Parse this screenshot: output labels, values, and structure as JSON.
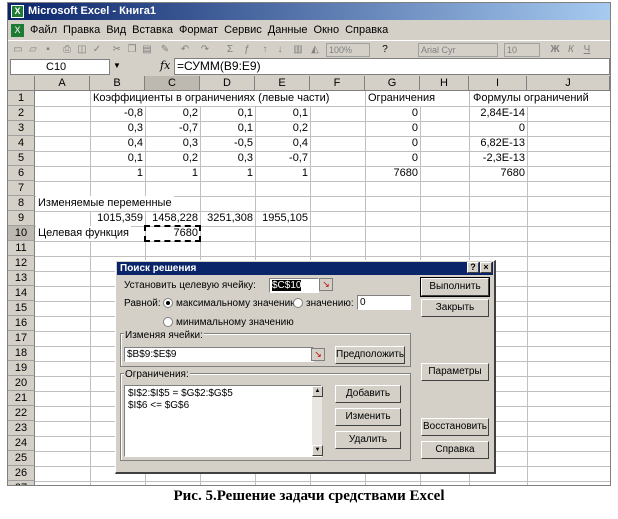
{
  "window": {
    "title": "Microsoft Excel - Книга1",
    "icon": "excel-icon"
  },
  "menu": [
    "Файл",
    "Правка",
    "Вид",
    "Вставка",
    "Формат",
    "Сервис",
    "Данные",
    "Окно",
    "Справка"
  ],
  "toolbar": {
    "zoom": "100%",
    "font": "Arial Cyr",
    "size": "10"
  },
  "formula_bar": {
    "cell_ref": "C10",
    "fx": "fx",
    "formula": "=СУММ(B9:E9)"
  },
  "columns": [
    "A",
    "B",
    "C",
    "D",
    "E",
    "F",
    "G",
    "H",
    "I",
    "J"
  ],
  "rows": [
    "1",
    "2",
    "3",
    "4",
    "5",
    "6",
    "7",
    "8",
    "9",
    "10",
    "11",
    "12",
    "13",
    "14",
    "15",
    "16",
    "17",
    "18",
    "19",
    "20",
    "21",
    "22",
    "23",
    "24",
    "25",
    "26",
    "27"
  ],
  "cells": {
    "b1": "Коэффициенты в ограничениях (левые части)",
    "g1": "Ограничения",
    "i1": "Формулы ограничений",
    "table": [
      [
        "-0,8",
        "0,2",
        "0,1",
        "0,1",
        "0",
        "2,84E-14"
      ],
      [
        "0,3",
        "-0,7",
        "0,1",
        "0,2",
        "0",
        "0"
      ],
      [
        "0,4",
        "0,3",
        "-0,5",
        "0,4",
        "0",
        "6,82E-13"
      ],
      [
        "0,1",
        "0,2",
        "0,3",
        "-0,7",
        "0",
        "-2,3E-13"
      ],
      [
        "1",
        "1",
        "1",
        "1",
        "7680",
        "7680"
      ]
    ],
    "a8": "Изменяемые переменные",
    "row9": [
      "1015,359",
      "1458,228",
      "3251,308",
      "1955,105"
    ],
    "a10": "Целевая функция",
    "c10": "7680"
  },
  "dialog": {
    "title": "Поиск решения",
    "help_btn": "?",
    "close_btn": "×",
    "target_label": "Установить целевую ячейку:",
    "target_value": "$C$10",
    "equal_label": "Равной:",
    "opt_max": "максимальному значению",
    "opt_value": "значению:",
    "value_input": "0",
    "opt_min": "минимальному значению",
    "changing_label": "Изменяя ячейки:",
    "changing_value": "$B$9:$E$9",
    "guess_btn": "Предположить",
    "constraints_label": "Ограничения:",
    "constraints": [
      "$I$2:$I$5 = $G$2:$G$5",
      "$I$6 <= $G$6"
    ],
    "add_btn": "Добавить",
    "change_btn": "Изменить",
    "delete_btn": "Удалить",
    "solve_btn": "Выполнить",
    "close_btn2": "Закрыть",
    "options_btn": "Параметры",
    "reset_btn": "Восстановить",
    "help_btn2": "Справка"
  },
  "caption": "Рис. 5.Решение задачи средствами Excel"
}
